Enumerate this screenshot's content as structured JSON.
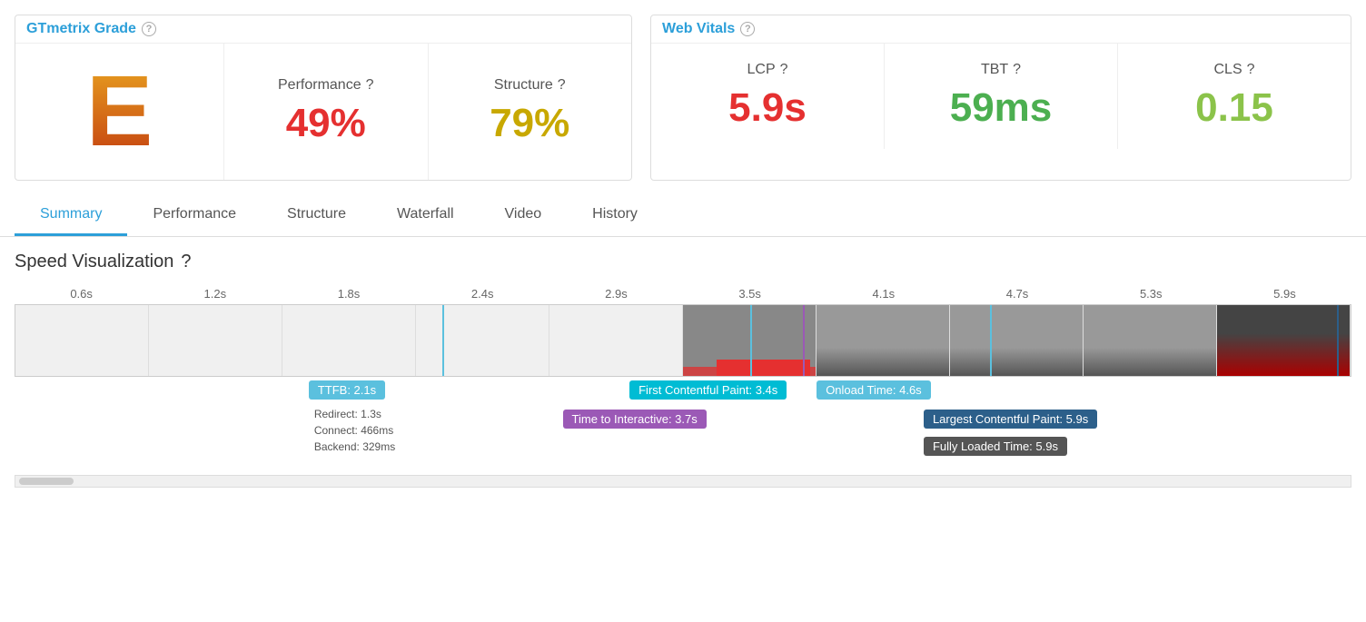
{
  "gtmetrix": {
    "header": "GTmetrix Grade",
    "help_label": "?",
    "grade_letter": "E",
    "performance_label": "Performance",
    "performance_help": "?",
    "performance_value": "49%",
    "structure_label": "Structure",
    "structure_help": "?",
    "structure_value": "79%"
  },
  "vitals": {
    "header": "Web Vitals",
    "help_label": "?",
    "lcp_label": "LCP",
    "lcp_help": "?",
    "lcp_value": "5.9s",
    "tbt_label": "TBT",
    "tbt_help": "?",
    "tbt_value": "59ms",
    "cls_label": "CLS",
    "cls_help": "?",
    "cls_value": "0.15"
  },
  "tabs": [
    {
      "label": "Summary",
      "active": true
    },
    {
      "label": "Performance",
      "active": false
    },
    {
      "label": "Structure",
      "active": false
    },
    {
      "label": "Waterfall",
      "active": false
    },
    {
      "label": "Video",
      "active": false
    },
    {
      "label": "History",
      "active": false
    }
  ],
  "speed": {
    "title": "Speed Visualization",
    "help": "?",
    "time_labels": [
      "0.6s",
      "1.2s",
      "1.8s",
      "2.4s",
      "2.9s",
      "3.5s",
      "4.1s",
      "4.7s",
      "5.3s",
      "5.9s"
    ],
    "annotations": {
      "ttfb_label": "TTFB: 2.1s",
      "ttfb_detail_redirect": "Redirect: 1.3s",
      "ttfb_detail_connect": "Connect: 466ms",
      "ttfb_detail_backend": "Backend: 329ms",
      "fcp_label": "First Contentful Paint: 3.4s",
      "tti_label": "Time to Interactive: 3.7s",
      "onload_label": "Onload Time: 4.6s",
      "lcp_label": "Largest Contentful Paint: 5.9s",
      "flt_label": "Fully Loaded Time: 5.9s"
    }
  }
}
